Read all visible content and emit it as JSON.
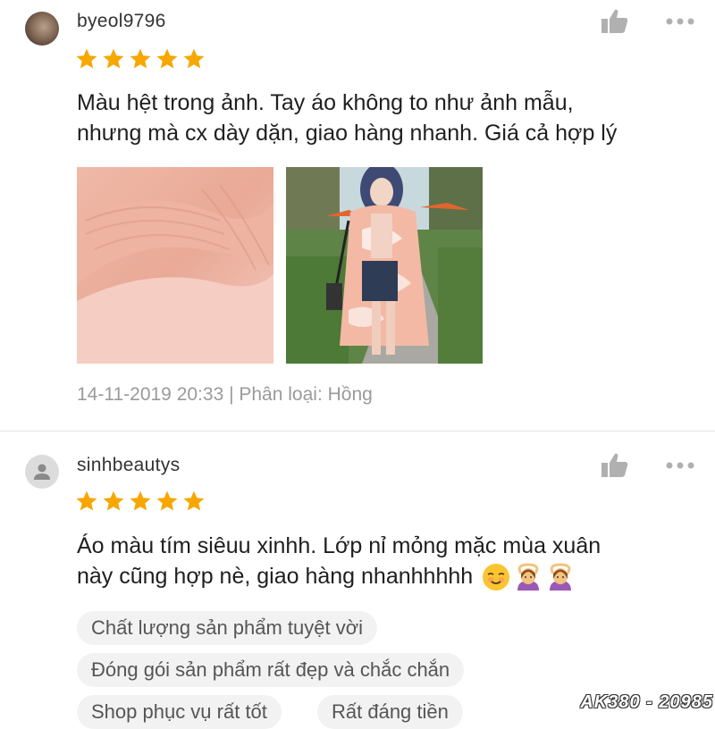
{
  "reviews": [
    {
      "username": "byeol9796",
      "rating": 5,
      "comment_lines": [
        "Màu hệt trong ảnh. Tay áo không to như ảnh mẫu,",
        "nhưng mà cx dày dặn, giao hàng nhanh. Giá cả hợp lý"
      ],
      "meta": "14-11-2019 20:33 | Phân loại: Hồng"
    },
    {
      "username": "sinhbeautys",
      "rating": 5,
      "comment_lines": [
        "Áo màu tím siêuu xinhh. Lớp nỉ mỏng mặc mùa xuân",
        "này cũng hợp nè,  giao hàng nhanhhhhh"
      ],
      "tags": [
        "Chất lượng sản phẩm tuyệt vời",
        "Đóng gói sản phẩm rất đẹp và chắc chắn",
        "Shop phục vụ rất tốt",
        "Rất đáng tiền"
      ]
    }
  ],
  "watermark": "AK380 - 20985",
  "colors": {
    "star": "#f6a700",
    "icon": "#b0b0b0",
    "meta": "#9a9a9a"
  },
  "icons": [
    "thumbs-up-icon",
    "more-options-icon",
    "star-icon",
    "default-user-icon"
  ]
}
